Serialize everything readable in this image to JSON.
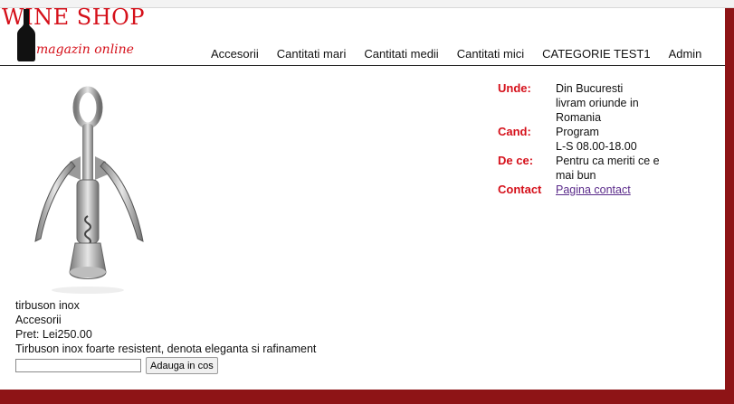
{
  "logo": {
    "title": "WINE SHOP",
    "subtitle": "magazin online"
  },
  "nav": {
    "items": [
      {
        "label": "Accesorii"
      },
      {
        "label": "Cantitati mari"
      },
      {
        "label": "Cantitati medii"
      },
      {
        "label": "Cantitati mici"
      },
      {
        "label": "CATEGORIE TEST1"
      },
      {
        "label": "Admin"
      }
    ]
  },
  "product": {
    "name": "tirbuson inox",
    "category": "Accesorii",
    "price": "Pret: Lei250.00",
    "description": "Tirbuson inox foarte resistent, denota eleganta si rafinament",
    "quantity_value": "",
    "add_button": "Adauga in cos"
  },
  "info": {
    "unde_label": "Unde:",
    "unde_lines": [
      "Din Bucuresti",
      "livram oriunde in",
      "Romania"
    ],
    "cand_label": "Cand:",
    "cand_lines": [
      "Program",
      "L-S 08.00-18.00"
    ],
    "dece_label": "De ce:",
    "dece_lines": [
      "Pentru ca meriti ce e",
      "mai bun"
    ],
    "contact_label": "Contact",
    "contact_link": "Pagina contact"
  },
  "colors": {
    "accent": "#d5101a",
    "background": "#8e1416"
  }
}
